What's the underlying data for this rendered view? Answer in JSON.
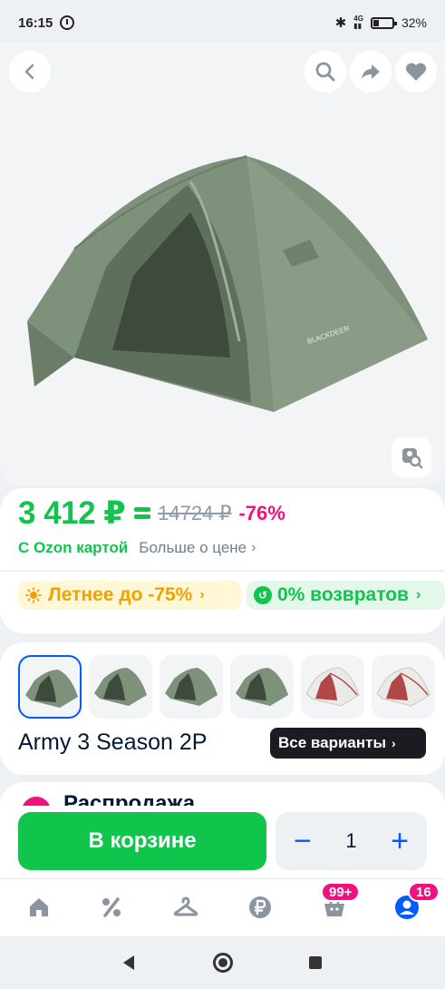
{
  "status_bar": {
    "time": "16:15",
    "network": "4G",
    "battery": "32%",
    "icons": [
      "alarm-icon",
      "bluetooth-icon",
      "signal-icon",
      "battery-icon"
    ]
  },
  "product_image": {
    "brand_print": "BLACKDEER",
    "toolbar_icons": [
      "back-icon",
      "search-icon",
      "share-icon",
      "heart-icon"
    ],
    "visual_search_icon": "visual-search-icon"
  },
  "price": {
    "current": "3 412 ₽",
    "old": "14724 ₽",
    "discount": "-76%",
    "card_label": "С Ozon картой",
    "more_link": "Больше о цене",
    "chevron": "›"
  },
  "promos": [
    {
      "label": "Летнее до -75%",
      "chevron": "›",
      "icon": "sun-icon"
    },
    {
      "label": "0% возвратов",
      "chevron": "›",
      "icon": "return-icon"
    }
  ],
  "variants": {
    "selected_name": "Army 3 Season 2P",
    "all_button": "Все варианты",
    "chevron": "›",
    "thumb_brand": "BLACKDEER",
    "thumbs": [
      {
        "color": "green",
        "selected": true
      },
      {
        "color": "green",
        "selected": false
      },
      {
        "color": "green",
        "selected": false
      },
      {
        "color": "green",
        "selected": false
      },
      {
        "color": "white-red",
        "selected": false
      },
      {
        "color": "white-red",
        "selected": false
      }
    ]
  },
  "sale_section": {
    "title": "Распродажа",
    "chevron": "›"
  },
  "cart": {
    "button_label": "В корзине",
    "minus": "−",
    "quantity": "1",
    "plus": "+"
  },
  "tabbar": {
    "icons": [
      "home-icon",
      "percent-icon",
      "hanger-icon",
      "ruble-icon",
      "basket-icon",
      "profile-icon"
    ],
    "cart_badge": "99+",
    "profile_badge": "16"
  },
  "colors": {
    "green": "#10c44c",
    "pink": "#f1117e",
    "blue": "#005bff",
    "tent_green": "#7e917a"
  }
}
